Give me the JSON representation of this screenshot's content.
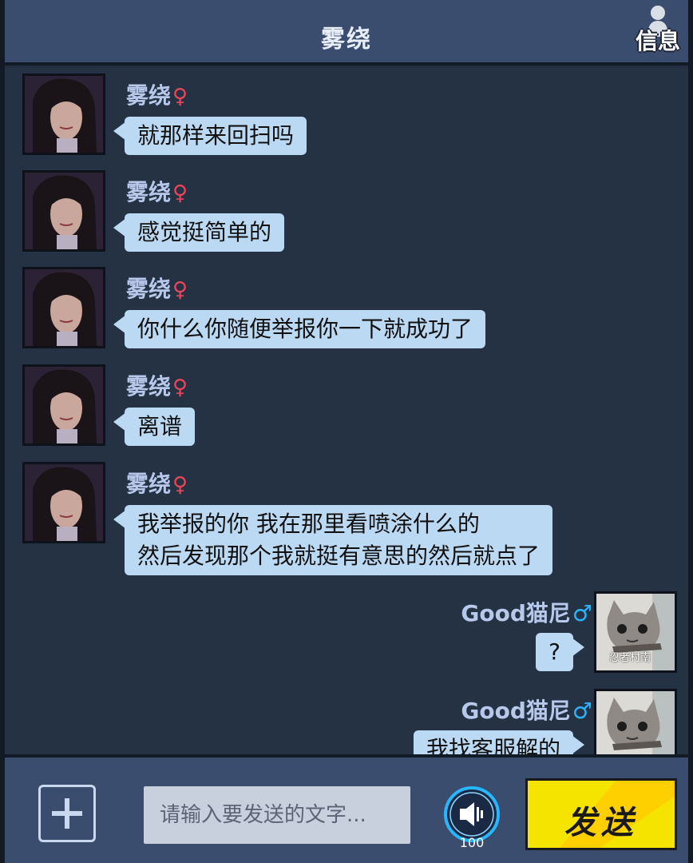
{
  "header": {
    "title": "雾绕",
    "info_label": "信息",
    "info_icon": "person-icon"
  },
  "left_messages": [
    {
      "sender": "雾绕",
      "gender": "♀",
      "text": "就那样来回扫吗"
    },
    {
      "sender": "雾绕",
      "gender": "♀",
      "text": "感觉挺简单的"
    },
    {
      "sender": "雾绕",
      "gender": "♀",
      "text": "你什么你随便举报你一下就成功了"
    },
    {
      "sender": "雾绕",
      "gender": "♀",
      "text": "离谱"
    },
    {
      "sender": "雾绕",
      "gender": "♀",
      "text_line1": "我举报的你 我在那里看喷涂什么的",
      "text_line2": "然后发现那个我就挺有意思的然后就点了"
    }
  ],
  "right_messages": [
    {
      "sender": "Good猫尼",
      "gender": "♂",
      "text": "?",
      "avatar_caption": "忍者村南"
    },
    {
      "sender": "Good猫尼",
      "gender": "♂",
      "text": "我找客服解的"
    }
  ],
  "footer": {
    "plus_icon": "plus-icon",
    "input_placeholder": "请输入要发送的文字...",
    "voice_icon": "speaker-icon",
    "voice_count": "100",
    "send_label": "发送"
  },
  "colors": {
    "header_bg": "#3b4d6e",
    "chat_bg": "#253244",
    "bubble_bg": "#bcd9f4",
    "name_color": "#b7c8ea",
    "female_symbol": "#e8465a",
    "male_symbol": "#2ab3ff",
    "send_button": "#f5e400"
  }
}
